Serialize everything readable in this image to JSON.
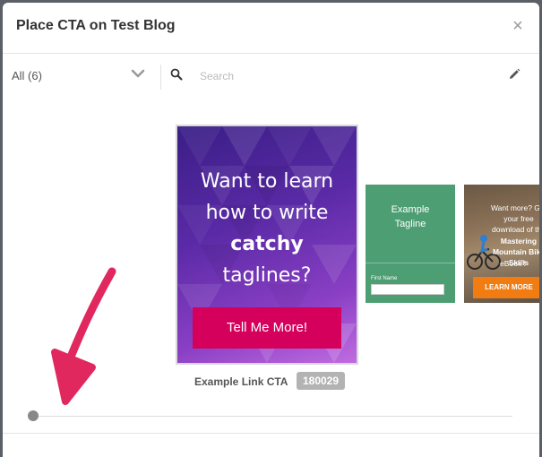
{
  "modal": {
    "title": "Place CTA on Test Blog",
    "close_label": "×"
  },
  "toolbar": {
    "filter_label": "All (6)",
    "search_placeholder": "Search"
  },
  "cards": {
    "main": {
      "headline_line1": "Want to learn",
      "headline_line2": "how to write",
      "headline_bold": "catchy",
      "headline_line4": "taglines?",
      "button_label": "Tell Me More!",
      "name": "Example Link CTA",
      "id": "180029"
    },
    "green": {
      "tagline_line1": "Example",
      "tagline_line2": "Tagline",
      "field_label": "First Name"
    },
    "bike": {
      "line1": "Want more? Get",
      "line2": "your free",
      "line3": "download of the",
      "title_line1": "Mastering",
      "title_line2": "Mountain Bike",
      "title_line3": "Skills",
      "sub": "eBook !",
      "button_label": "LEARN MORE"
    }
  },
  "slider": {
    "position": 0
  },
  "colors": {
    "accent_pink": "#d4005c",
    "green_card": "#4d9e73",
    "orange_button": "#f07c12",
    "arrow": "#e0285f"
  },
  "icons": [
    "close-icon",
    "chevron-down-icon",
    "search-icon",
    "pencil-icon",
    "arrow-annotation"
  ]
}
